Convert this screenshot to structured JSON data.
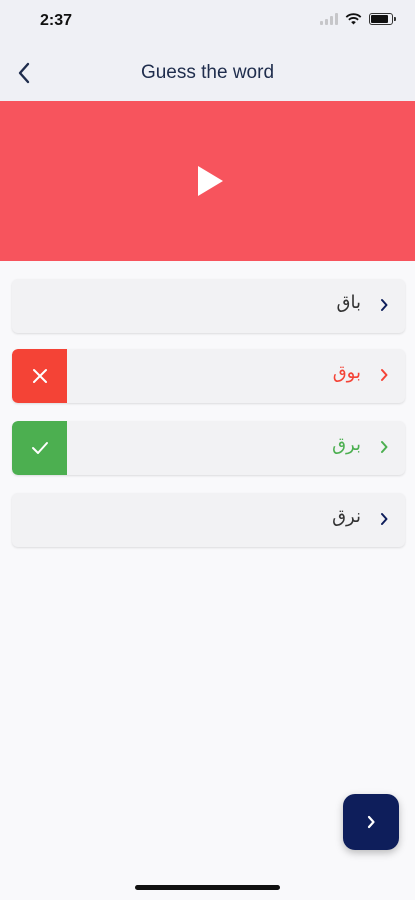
{
  "status_bar": {
    "time": "2:37",
    "battery_level": 0.9
  },
  "header": {
    "title": "Guess the word",
    "back_icon": "chevron-left-icon"
  },
  "audio_banner": {
    "color": "#f7545d",
    "play_icon": "play-icon"
  },
  "options": [
    {
      "word": "باق",
      "state": "neutral",
      "text_color": "#333333"
    },
    {
      "word": "بوق",
      "state": "wrong",
      "status_icon": "close-icon",
      "status_color": "#f44336",
      "text_color": "#f44336"
    },
    {
      "word": "برق",
      "state": "correct",
      "status_icon": "checkmark-icon",
      "status_color": "#4caf50",
      "text_color": "#4caf50"
    },
    {
      "word": "نرق",
      "state": "neutral",
      "text_color": "#333333"
    }
  ],
  "next_button": {
    "icon": "chevron-right-icon",
    "color": "#0e1e5b"
  }
}
